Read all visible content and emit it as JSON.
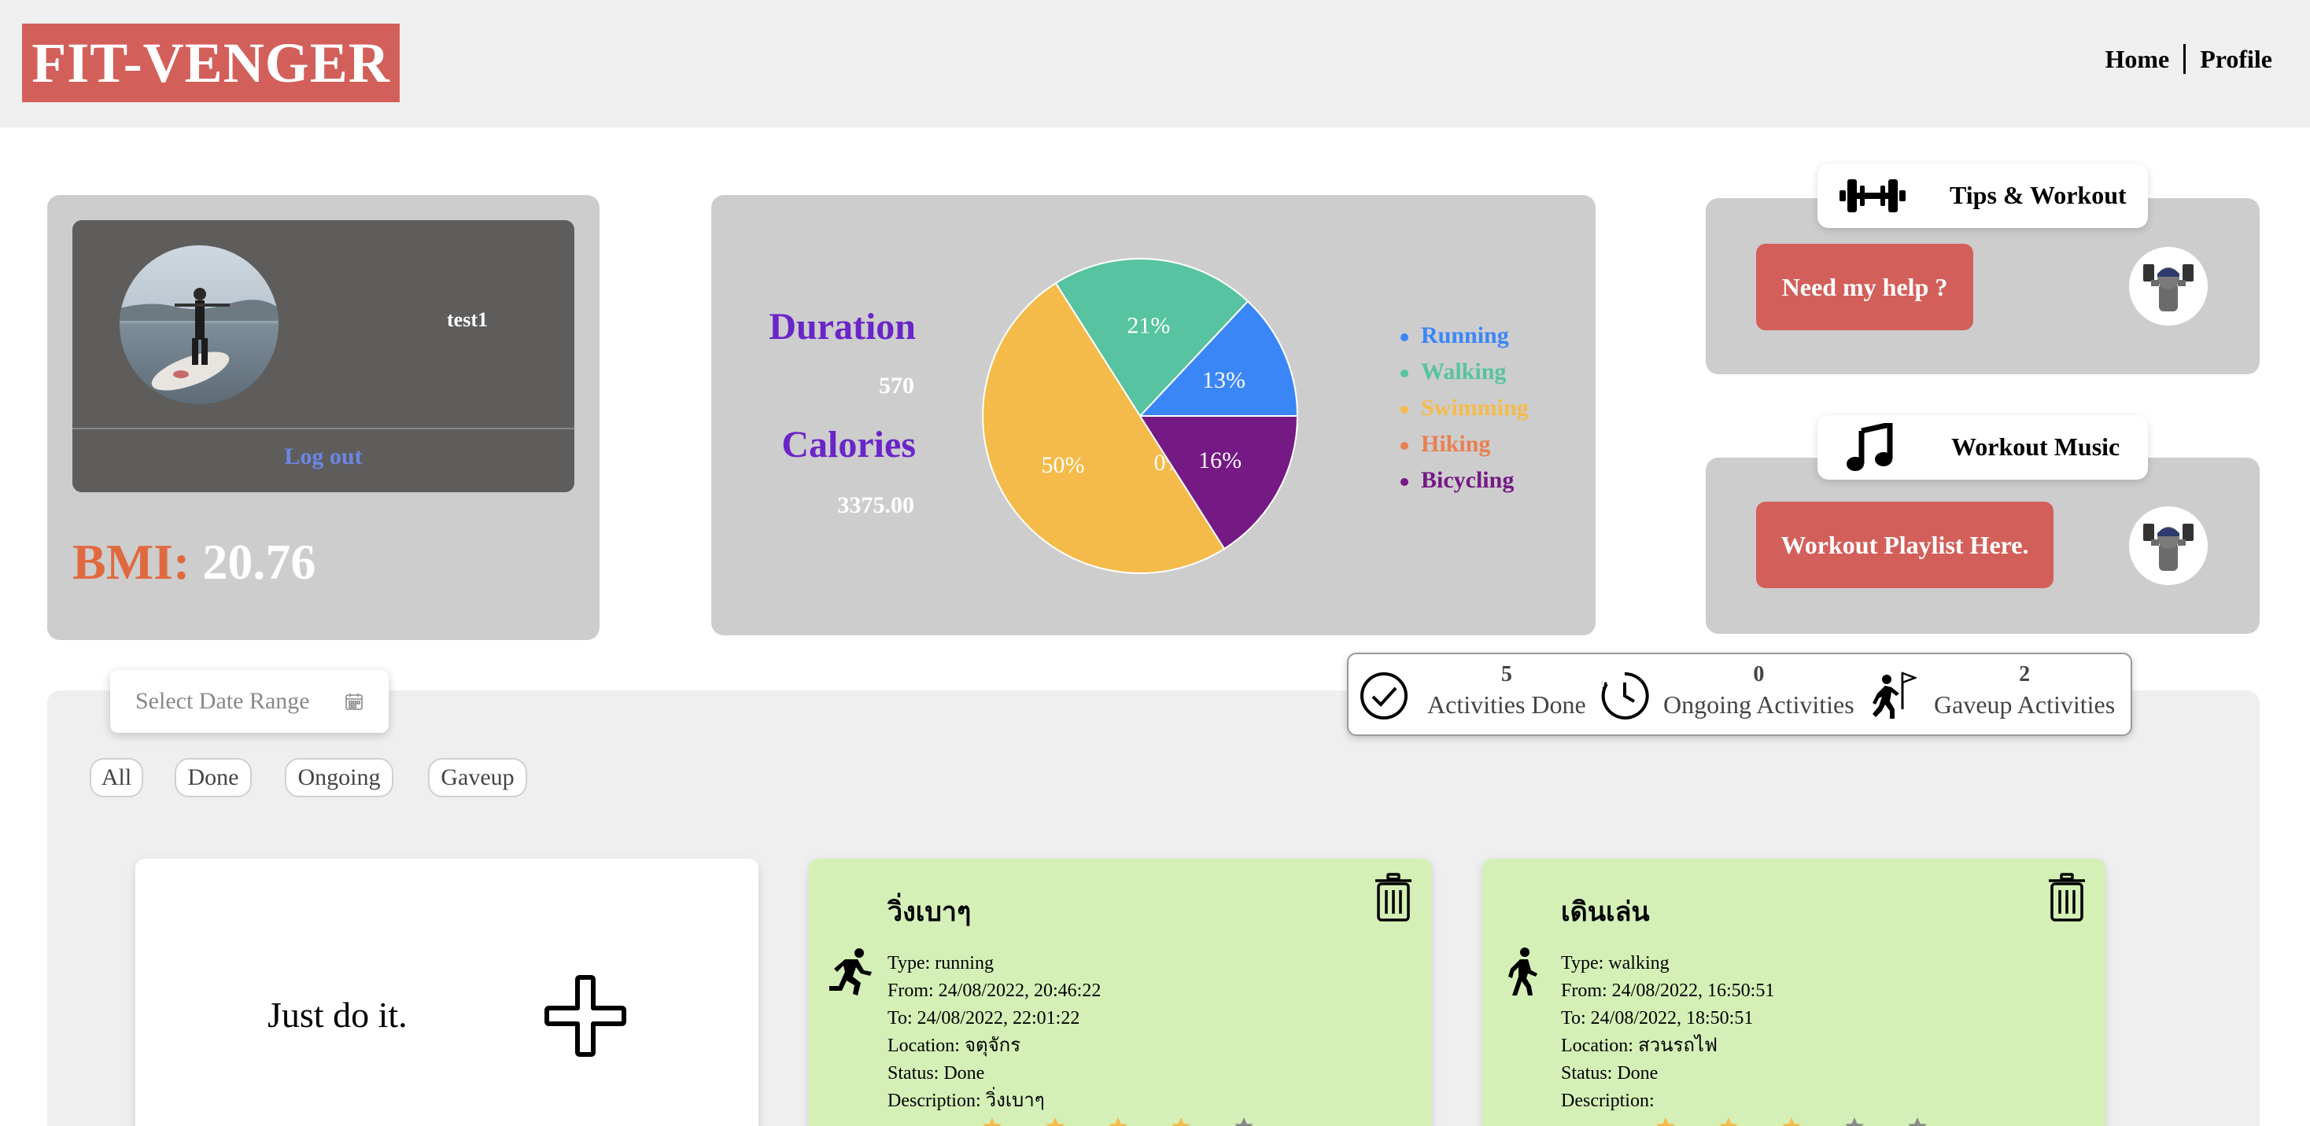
{
  "header": {
    "logo": "FIT-VENGER",
    "nav": [
      "Home",
      "Profile"
    ]
  },
  "profile": {
    "username": "test1",
    "logout_label": "Log out",
    "bmi_label": "BMI:",
    "bmi_value": "20.76"
  },
  "stats": {
    "duration_label": "Duration",
    "duration_value": "570",
    "calories_label": "Calories",
    "calories_value": "3375.00"
  },
  "chart_data": {
    "type": "pie",
    "labels": [
      "Running",
      "Walking",
      "Swimming",
      "Hiking",
      "Bicycling"
    ],
    "values": [
      13,
      21,
      50,
      0,
      16
    ],
    "data_labels": [
      "13%",
      "21%",
      "50%",
      "0%",
      "16%"
    ],
    "colors": [
      "#3b86f7",
      "#57c3a0",
      "#f4bb4b",
      "#e97f52",
      "#751985"
    ],
    "legend_position": "right"
  },
  "tips": {
    "title": "Tips & Workout",
    "button": "Need my help ?"
  },
  "music": {
    "title": "Workout Music",
    "button": "Workout Playlist Here."
  },
  "date_picker": {
    "placeholder": "Select Date Range"
  },
  "filters": [
    "All",
    "Done",
    "Ongoing",
    "Gaveup"
  ],
  "summary": [
    {
      "count": "5",
      "label": "Activities Done"
    },
    {
      "count": "0",
      "label": "Ongoing Activities"
    },
    {
      "count": "2",
      "label": "Gaveup Activities"
    }
  ],
  "add_card": {
    "slogan": "Just do it."
  },
  "activities": [
    {
      "title": "วิ่งเบาๆ",
      "type": "Type: running",
      "from": "From: 24/08/2022, 20:46:22",
      "to": "To: 24/08/2022, 22:01:22",
      "location": "Location: จตุจักร",
      "status": "Status: Done",
      "description": "Description: วิ่งเบาๆ",
      "rating": 4
    },
    {
      "title": "เดินเล่น",
      "type": "Type: walking",
      "from": "From: 24/08/2022, 16:50:51",
      "to": "To: 24/08/2022, 18:50:51",
      "location": "Location: สวนรถไฟ",
      "status": "Status: Done",
      "description": "Description:",
      "rating": 3
    }
  ],
  "colors": {
    "brand_red": "#d35f5b",
    "panel_grey": "#cdcdcd",
    "card_green": "#d4f0b7",
    "accent_purple": "#6a25c8",
    "bmi_orange": "#e06a3f"
  }
}
